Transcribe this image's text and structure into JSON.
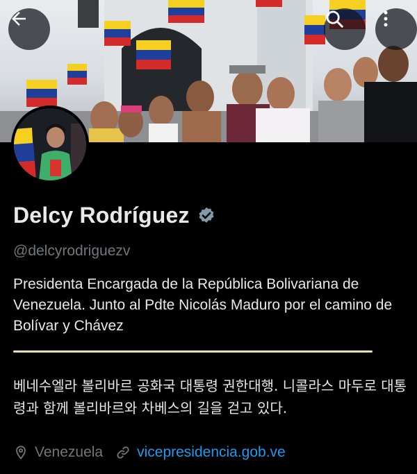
{
  "header": {
    "back_icon": "arrow-left-icon",
    "search_icon": "search-icon",
    "more_icon": "more-vertical-icon"
  },
  "profile": {
    "name": "Delcy Rodríguez",
    "verified_icon": "verified-badge-icon",
    "handle": "@delcyrodriguezv",
    "bio": "Presidenta Encargada de la República Bolivariana de Venezuela. Junto al Pdte Nicolás Maduro por el camino de Bolívar y Chávez",
    "translation": "베네수엘라 볼리바르 공화국 대통령 권한대행. 니콜라스 마두로 대통령과 함께 볼리바르와 차베스의 길을 걷고 있다.",
    "location": "Venezuela",
    "location_icon": "location-pin-icon",
    "website": "vicepresidencia.gob.ve",
    "website_icon": "link-icon"
  },
  "colors": {
    "background": "#000000",
    "primary_text": "#e7e9ea",
    "secondary_text": "#71767b",
    "link": "#1d9bf0",
    "verified_badge": "#829aab",
    "divider": "#efe2a8"
  }
}
